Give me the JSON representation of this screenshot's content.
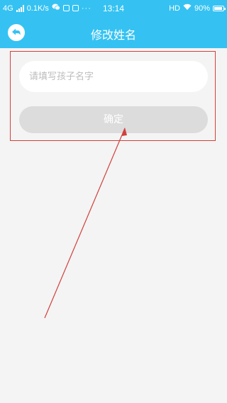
{
  "status_bar": {
    "network": "4G",
    "speed": "0.1K/s",
    "time": "13:14",
    "hd": "HD",
    "battery": "90%",
    "dots": "···"
  },
  "header": {
    "title": "修改姓名",
    "back_icon": "back-icon"
  },
  "form": {
    "name_placeholder": "请填写孩子名字",
    "name_value": "",
    "confirm_label": "确定"
  },
  "colors": {
    "accent": "#35c2f2",
    "background": "#f4f4f4",
    "button_disabled": "#dcdcdc",
    "annotation_red": "#d0413c"
  }
}
